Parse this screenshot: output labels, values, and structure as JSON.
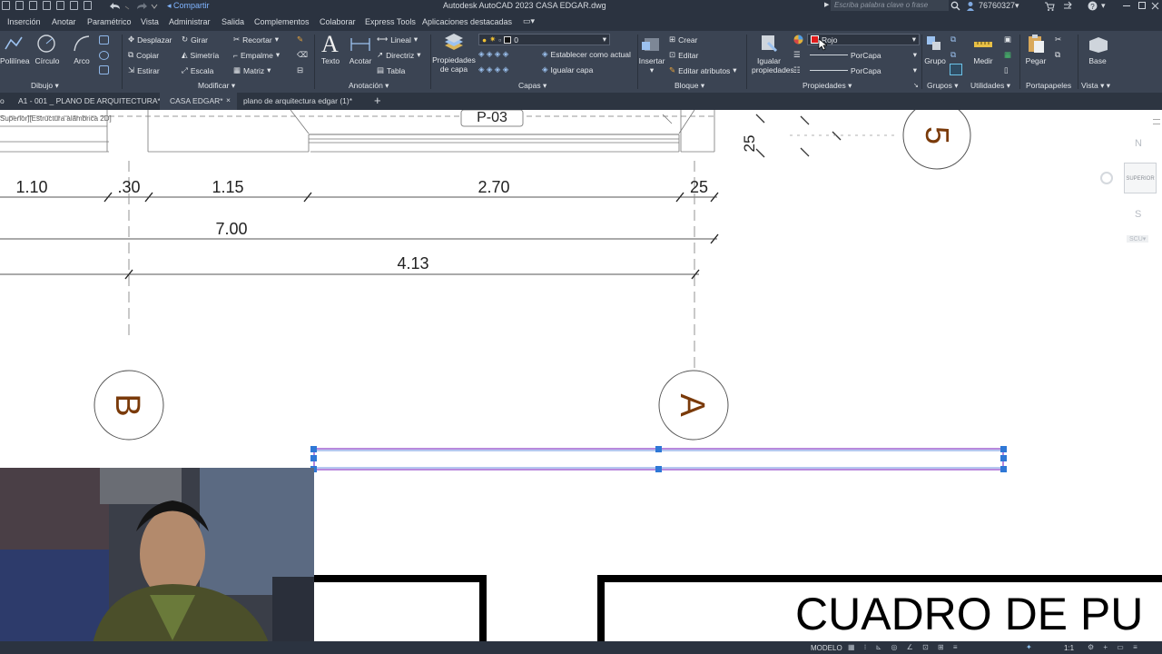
{
  "titlebar": {
    "share": "Compartir",
    "app_title": "Autodesk AutoCAD 2023    CASA EDGAR.dwg",
    "search_placeholder": "Escriba palabra clave o frase",
    "user": "76760327"
  },
  "menu": [
    "Inserción",
    "Anotar",
    "Paramétrico",
    "Vista",
    "Administrar",
    "Salida",
    "Complementos",
    "Colaborar",
    "Express Tools",
    "Aplicaciones destacadas"
  ],
  "ribbon": {
    "dibujo": {
      "label": "Dibujo",
      "polilinea": "Polilínea",
      "circulo": "Círculo",
      "arco": "Arco"
    },
    "modificar": {
      "label": "Modificar",
      "desplazar": "Desplazar",
      "girar": "Girar",
      "recortar": "Recortar",
      "copiar": "Copiar",
      "simetria": "Simetría",
      "empalme": "Empalme",
      "estirar": "Estirar",
      "escala": "Escala",
      "matriz": "Matriz"
    },
    "anotacion": {
      "label": "Anotación",
      "texto": "Texto",
      "acotar": "Acotar",
      "lineal": "Lineal",
      "directriz": "Directriz",
      "tabla": "Tabla"
    },
    "capas": {
      "label": "Capas",
      "propiedades": "Propiedades de capa",
      "layer_value": "0",
      "establecer": "Establecer como actual",
      "igualar": "Igualar capa"
    },
    "bloque": {
      "label": "Bloque",
      "insertar": "Insertar",
      "crear": "Crear",
      "editar": "Editar",
      "editar_atributos": "Editar atributos"
    },
    "propiedades": {
      "label": "Propiedades",
      "igualar": "Igualar propiedades",
      "color": "Rojo",
      "color_hex": "#e01b1b",
      "linetype": "PorCapa",
      "lineweight": "PorCapa"
    },
    "grupos": {
      "label": "Grupos",
      "grupo": "Grupo"
    },
    "utilidades": {
      "label": "Utilidades",
      "medir": "Medir"
    },
    "portapapeles": {
      "label": "Portapapeles",
      "pegar": "Pegar"
    },
    "vista": {
      "label": "Vista",
      "base": "Base"
    }
  },
  "tabs": {
    "t0": "o",
    "t1": "A1 - 001 _ PLANO DE ARQUITECTURA*",
    "t2": "CASA EDGAR*",
    "t3": "plano de arquitectura edgar (1)*",
    "add": "+"
  },
  "viewport": {
    "label": "Superior][Estructura alámbrica 2D]"
  },
  "drawing": {
    "tag": "P-03",
    "dim_top": "25",
    "dims_row1": [
      "1.10",
      ".30",
      "1.15",
      "2.70",
      "25"
    ],
    "dim_total": "7.00",
    "dim_inner": "4.13",
    "axis_b": "B",
    "axis_a": "A",
    "axis_5": "5",
    "title_text": "CUADRO DE PU"
  },
  "viewcube": {
    "n": "N",
    "face": "SUPERIOR",
    "s": "S",
    "scu": "SCU"
  },
  "status": {
    "model": "MODELO",
    "scale": "1:1"
  },
  "colors": {
    "titlebar": "#2b3340",
    "ribbon": "#3b4453",
    "selection": "#8a3cc6",
    "grip": "#2f78d6",
    "axis_text": "#7a3a0a"
  }
}
